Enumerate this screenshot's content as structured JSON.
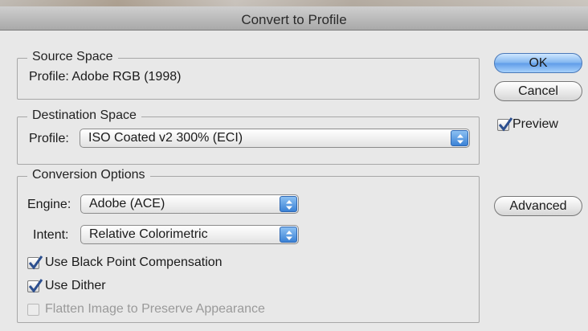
{
  "dialog": {
    "title": "Convert to Profile"
  },
  "source_space": {
    "legend": "Source Space",
    "profile_text": "Profile:  Adobe RGB (1998)"
  },
  "destination_space": {
    "legend": "Destination Space",
    "profile_label": "Profile:",
    "profile_value": "ISO Coated v2 300% (ECI)"
  },
  "conversion_options": {
    "legend": "Conversion Options",
    "engine_label": "Engine:",
    "engine_value": "Adobe (ACE)",
    "intent_label": "Intent:",
    "intent_value": "Relative Colorimetric",
    "black_point_label": "Use Black Point Compensation",
    "black_point_checked": true,
    "dither_label": "Use Dither",
    "dither_checked": true,
    "flatten_label": "Flatten Image to Preserve Appearance",
    "flatten_checked": false,
    "flatten_enabled": false
  },
  "buttons": {
    "ok": "OK",
    "cancel": "Cancel",
    "advanced": "Advanced"
  },
  "preview": {
    "label": "Preview",
    "checked": true
  },
  "colors": {
    "accent_blue": "#3b82d6",
    "checkmark_blue": "#2c4f8f",
    "background": "#e8e8e8"
  },
  "icons": {
    "popup_arrows": "up-down-arrows-icon",
    "checkmark": "checkmark-icon"
  }
}
